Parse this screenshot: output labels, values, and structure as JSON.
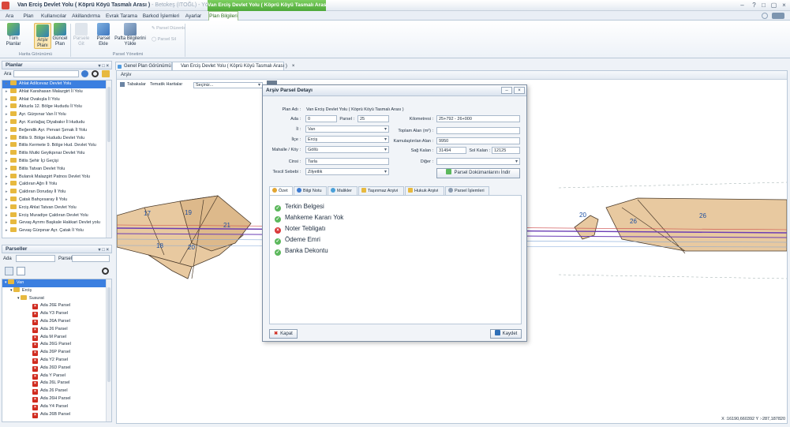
{
  "window": {
    "title_main": "Van Erciş Devlet Yolu ( Köprü Köyü Tasmalı Arası )",
    "title_sub": " - Betokeş (ITOĞL) - Yönetici",
    "context_tab_group": "Van Erciş Devlet Yolu ( Köprü Köyü Tasmalı Arası )"
  },
  "menu": {
    "tabs": [
      "Ara",
      "Plan",
      "Kullanıcılar",
      "Akillandırma",
      "Evrak Tarama",
      "Barkod İşlemleri",
      "Ayarlar"
    ],
    "active_tab": "Plan Bilgileri"
  },
  "ribbon": {
    "btn_tum_planlar": "Tüm Planlar",
    "btn_arsiv_plani_1": "Arşiv",
    "btn_arsiv_plani_2": "Planı",
    "btn_guncel_plan_1": "Güncel",
    "btn_guncel_plan_2": "Plan",
    "btn_parsele_git_1": "Parsele",
    "btn_parsele_git_2": "Git",
    "btn_parsel_ekle_1": "Parsel",
    "btn_parsel_ekle_2": "Ekle",
    "btn_pafta_1": "Pafta Bilgilerini",
    "btn_pafta_2": "Yükle",
    "btn_parsel_duzenle": "Parsel Düzenle",
    "btn_parsel_sil": "Parsel Sil",
    "group_harita": "Harita Görünümü",
    "group_parsel": "Parsel Yönetimi"
  },
  "planlar_panel": {
    "title": "Planlar",
    "search_label": "Ara",
    "items": [
      "Ahlat Adilcevaz Devlet Yolu",
      "Ahlat Karahasan Malazgirt İl Yolu",
      "Ahlat Ovakışla İl Yolu",
      "Aktuzla 12. Bölge Hududu İl Yolu",
      "Ayr. Gürpınar Van İl Yolu",
      "Ayr. Kızılağaç Diyabakır İl Hududu",
      "Beğendik Ayr. Pervari Şırnak İl Yolu",
      "Bitlis 9. Bölge Hududu Devlet Yolu",
      "Bitlis Kermete 9. Bölge Hud. Devlet Yolu",
      "Bitlis Mutki Geyikpınar Devlet Yolu",
      "Bitlis Şehir İçi Geçişi",
      "Bitlis Tatvan Devlet Yolu",
      "Bulanık Malazgirt Patnos Devlet Yolu",
      "Çaldıran Ağrı İl Yolu",
      "Çaldıran Doruday İl Yolu",
      "Çatak Bahçesaray İl Yolu",
      "Erciş Ahlat Tatvan Devlet Yolu",
      "Erciş Muradiye Çaldıran Devlet Yolu",
      "Gevaş Ayrımı Başkale Hakkari Devlet yolu",
      "Gevaş Gürpınar Ayr. Çatak İl Yolu"
    ]
  },
  "parseller_panel": {
    "title": "Parseller",
    "ada_label": "Ada",
    "parsel_label": "Parsel",
    "tree_root": "Van",
    "tree_ilce": "Erciş",
    "tree_mahalle": "Susurat",
    "items": [
      "Ada 26E Parsel",
      "Ada Y3 Parsel",
      "Ada 26A Parsel",
      "Ada 26 Parsel",
      "Ada M Parsel",
      "Ada 26G Parsel",
      "Ada 26P Parsel",
      "Ada Y2 Parsel",
      "Ada 26D Parsel",
      "Ada Y Parsel",
      "Ada 26L Parsel",
      "Ada 26 Parsel",
      "Ada 26H Parsel",
      "Ada Y4 Parsel",
      "Ada 26B Parsel"
    ]
  },
  "doc_tabs": {
    "tab1": "Genel Plan Görünümü",
    "tab2": "Van Erciş Devlet Yolu ( Köprü Köyü Tasmalı Arası )"
  },
  "map": {
    "archive_label": "Arşiv",
    "tabakalar": "Tabakalar",
    "tematik": "Tematik Haritalar",
    "select_placeholder": "Seçiniz...",
    "coords": "X :16190,660392 Y :-287,187820",
    "parcel_numbers": [
      "17",
      "19",
      "21",
      "18",
      "20",
      "20",
      "26",
      "26"
    ]
  },
  "dialog": {
    "title": "Arşiv Parsel Detayı",
    "plan_adi_label": "Plan Adı :",
    "plan_adi_value": "Van Erciş Devlet Yolu ( Köprü Köyü Tasmalı Arası )",
    "ada_label": "Ada :",
    "ada_value": "0",
    "parsel_label": "Parsel :",
    "parsel_value": "25",
    "il_label": "İl :",
    "il_value": "Van",
    "ilce_label": "İlçe :",
    "ilce_value": "Erciş",
    "mahalle_label": "Mahalle / Köy :",
    "mahalle_value": "Göllü",
    "cinsi_label": "Cinsi :",
    "cinsi_value": "Tarla",
    "tescil_label": "Tescil Sebebi :",
    "tescil_value": "Zilyetlik",
    "km_label": "Kilometresi :",
    "km_value": "25+792 - 26+000",
    "toplam_label": "Toplam Alan (m²) :",
    "toplam_value": "",
    "kamulas_label": "Kamulaştırılan Alan :",
    "kamulas_value": "9950",
    "sag_label": "Sağ Kalan :",
    "sag_value": "31494",
    "sol_label": "Sol Kalan :",
    "sol_value": "12125",
    "diger_label": "Diğer :",
    "diger_value": "",
    "indir_button": "Parsel Dokümanlarını İndir",
    "tabs": [
      "Özet",
      "Bilgi Notu",
      "Malikler",
      "Taşınmaz Arşivi",
      "Hukuk Arşivi",
      "Parsel İşlemleri"
    ],
    "status_items": [
      {
        "label": "Terkin Belgesi",
        "state": "ok"
      },
      {
        "label": "Mahkeme Kararı Yok",
        "state": "ok"
      },
      {
        "label": "Noter Tebligatı",
        "state": "error"
      },
      {
        "label": "Ödeme Emri",
        "state": "ok"
      },
      {
        "label": "Banka Dekontu",
        "state": "ok"
      }
    ],
    "kapat_button": "Kapat",
    "kaydet_button": "Kaydet"
  },
  "colors": {
    "accent_green": "#4ea83a",
    "selection_blue": "#3b7fe0",
    "ok_green": "#5cb85c",
    "error_red": "#d9383a",
    "parcel_fill": "#e8c9a0",
    "road_purple": "#6a3cb5"
  }
}
